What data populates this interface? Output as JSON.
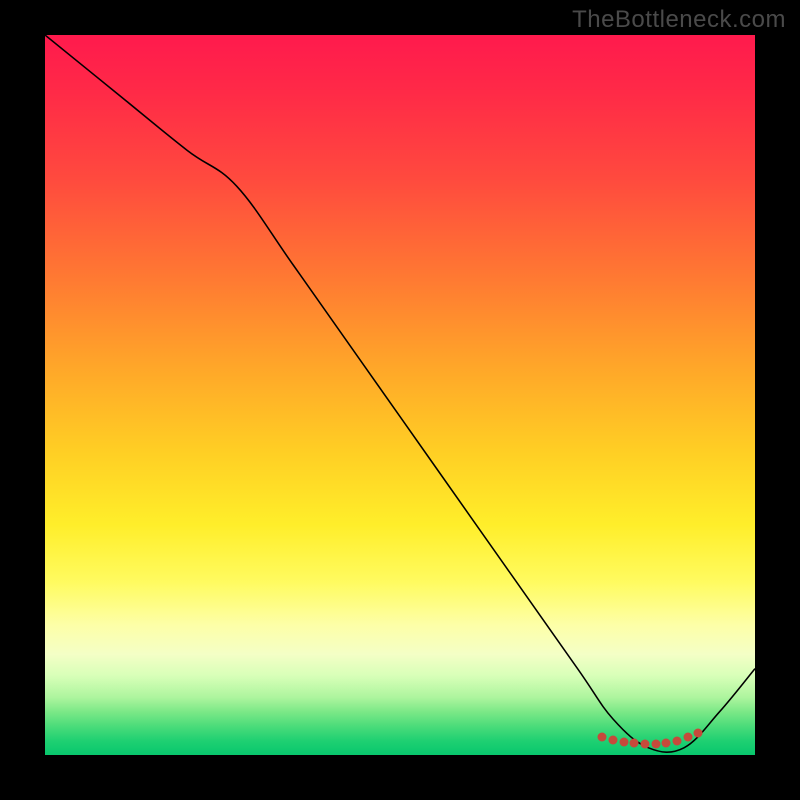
{
  "watermark": "TheBottleneck.com",
  "chart_data": {
    "type": "line",
    "title": "",
    "xlabel": "",
    "ylabel": "",
    "xlim": [
      0,
      100
    ],
    "ylim": [
      0,
      100
    ],
    "notes": "Single black curve over a vertical rainbow gradient (red top → green bottom). Curve descends from top-left, has a slight elbow ~27% across, reaches a flat minimum near zero around x≈85, then rises toward the right edge. Scattered rust-colored dots sit on the flat minimum.",
    "series": [
      {
        "name": "main-curve",
        "x": [
          0,
          10,
          20,
          27,
          35,
          45,
          55,
          65,
          75,
          80,
          85,
          90,
          95,
          100
        ],
        "y": [
          100,
          92,
          84,
          79,
          68,
          54,
          40,
          26,
          12,
          5,
          1,
          1,
          6,
          12
        ]
      }
    ],
    "markers": {
      "name": "min-dots",
      "color": "#c64a3b",
      "points": [
        {
          "x": 78.5,
          "y": 2.5
        },
        {
          "x": 80.0,
          "y": 2.1
        },
        {
          "x": 81.5,
          "y": 1.8
        },
        {
          "x": 83.0,
          "y": 1.6
        },
        {
          "x": 84.5,
          "y": 1.5
        },
        {
          "x": 86.0,
          "y": 1.5
        },
        {
          "x": 87.5,
          "y": 1.7
        },
        {
          "x": 89.0,
          "y": 2.0
        },
        {
          "x": 90.5,
          "y": 2.5
        },
        {
          "x": 92.0,
          "y": 3.0
        }
      ]
    },
    "gradient_stops": [
      {
        "pos": 0.0,
        "color": "#ff1a4d"
      },
      {
        "pos": 0.2,
        "color": "#ff4a3e"
      },
      {
        "pos": 0.46,
        "color": "#ffa629"
      },
      {
        "pos": 0.68,
        "color": "#ffee2a"
      },
      {
        "pos": 0.86,
        "color": "#f4ffc6"
      },
      {
        "pos": 1.0,
        "color": "#08c76d"
      }
    ]
  }
}
